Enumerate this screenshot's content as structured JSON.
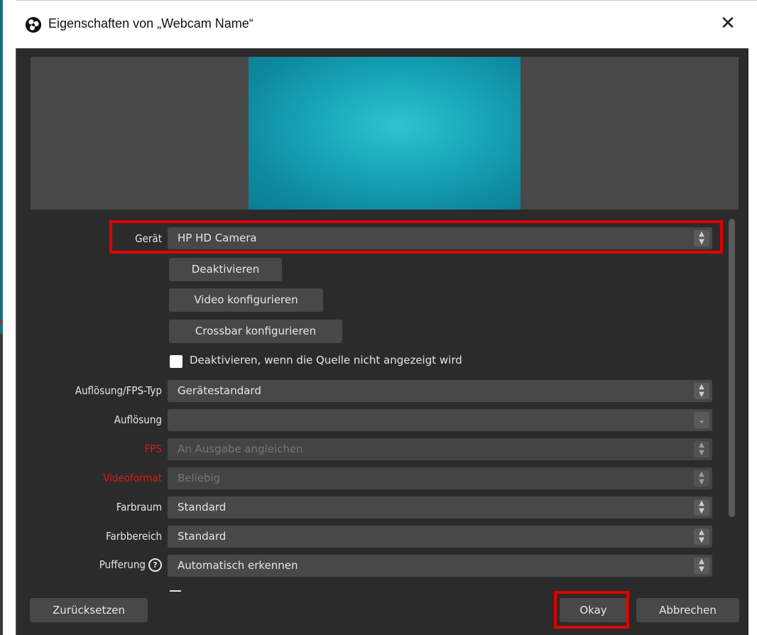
{
  "window": {
    "title": "Eigenschaften von „Webcam Name“",
    "close_glyph": "✕",
    "app_icon": "obs-logo-icon"
  },
  "properties": {
    "device": {
      "label": "Gerät",
      "value": "HP HD Camera"
    },
    "buttons": {
      "deactivate": "Deaktivieren",
      "configure_video": "Video konfigurieren",
      "configure_crossbar": "Crossbar konfigurieren"
    },
    "deactivate_when_hidden": {
      "label": "Deaktivieren, wenn die Quelle nicht angezeigt wird",
      "checked": false
    },
    "resolution_fps_type": {
      "label": "Auflösung/FPS-Typ",
      "value": "Gerätestandard"
    },
    "resolution": {
      "label": "Auflösung",
      "value": ""
    },
    "fps": {
      "label": "FPS",
      "value": "An Ausgabe angleichen"
    },
    "video_format": {
      "label": "Videoformat",
      "value": "Beliebig"
    },
    "color_space": {
      "label": "Farbraum",
      "value": "Standard"
    },
    "color_range": {
      "label": "Farbbereich",
      "value": "Standard"
    },
    "buffering": {
      "label": "Pufferung",
      "value": "Automatisch erkennen",
      "help_icon": "help-circle-icon"
    }
  },
  "footer": {
    "reset": "Zurücksetzen",
    "ok": "Okay",
    "cancel": "Abbrechen"
  },
  "colors": {
    "dialog_bg": "#2b2b2b",
    "control_bg": "#484848",
    "highlight": "#e00000",
    "invalid_label": "#e01818",
    "preview_video": "#18a6b8"
  }
}
